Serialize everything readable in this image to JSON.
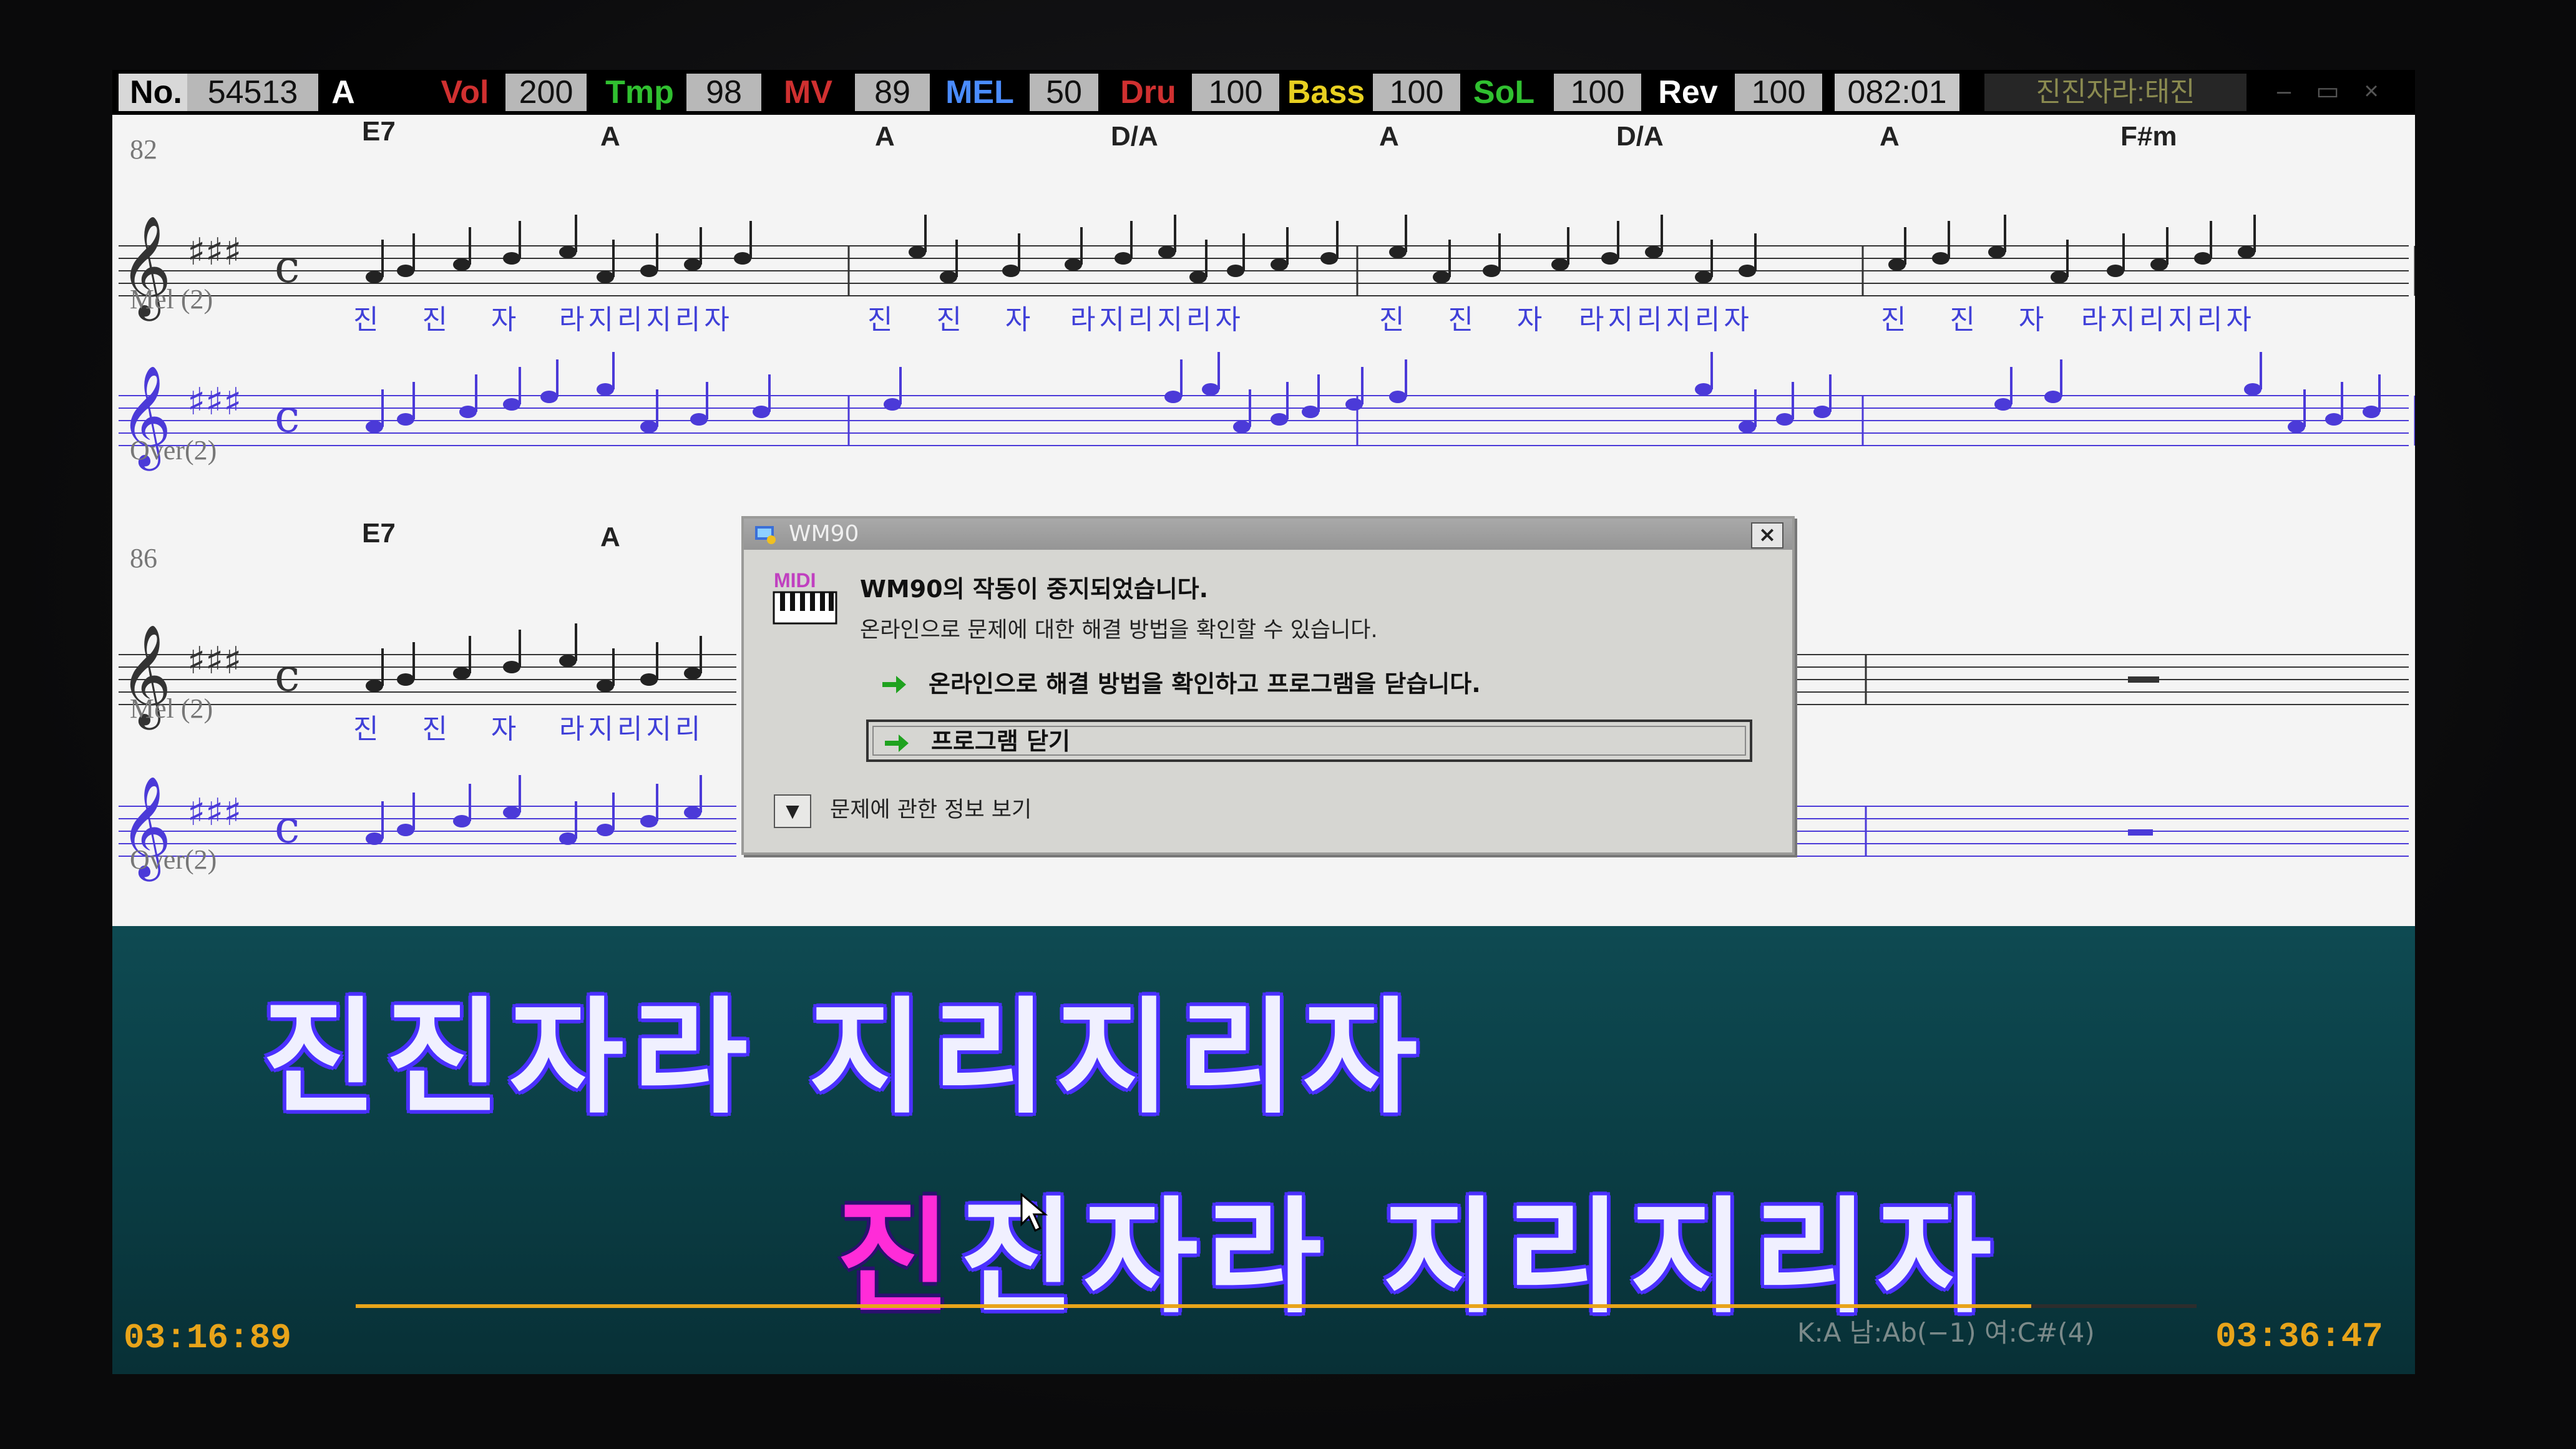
{
  "status_bar": {
    "items": [
      {
        "label": "No.",
        "value": "54513",
        "color": "#ffffff"
      },
      {
        "label": "A",
        "value": "",
        "color": "#ffffff"
      },
      {
        "label": "Vol",
        "value": "200",
        "color": "#d03030"
      },
      {
        "label": "Tmp",
        "value": "98",
        "color": "#30c030"
      },
      {
        "label": "MV",
        "value": "89",
        "color": "#d03030"
      },
      {
        "label": "MEL",
        "value": "50",
        "color": "#4a8cff"
      },
      {
        "label": "Dru",
        "value": "100",
        "color": "#d03030"
      },
      {
        "label": "Bass",
        "value": "100",
        "color": "#e8d020"
      },
      {
        "label": "SoL",
        "value": "100",
        "color": "#30c030"
      },
      {
        "label": "Rev",
        "value": "100",
        "color": "#ffffff"
      }
    ],
    "clock": "082:01",
    "song_title": "진진자라:태진"
  },
  "score": {
    "system1": {
      "measure": "82",
      "chords": [
        "E7",
        "A",
        "A",
        "D/A",
        "A",
        "D/A",
        "A",
        "F#m"
      ],
      "track1": "Mel (2)",
      "track2": "Over(2)",
      "lyrics": [
        "진 진 자",
        "라지리지리자",
        "진 진 자",
        "라지리지리자",
        "진 진 자",
        "라지리지리자",
        "진 진 자",
        "라지리지리자"
      ]
    },
    "system2": {
      "measure": "86",
      "chords": [
        "E7",
        "A"
      ],
      "track1": "Mel (2)",
      "track2": "Over(2)",
      "lyrics": [
        "진 진 자",
        "라지리지리"
      ]
    }
  },
  "dialog": {
    "title": "WM90",
    "close": "×",
    "icon_text": "MIDI",
    "heading": "WM90의 작동이 중지되었습니다.",
    "subtext": "온라인으로 문제에 대한 해결 방법을 확인할 수 있습니다.",
    "option_check_online": "온라인으로 해결 방법을 확인하고 프로그램을 닫습니다.",
    "option_close": "프로그램 닫기",
    "details": "문제에 관한 정보 보기",
    "arrow_color": "#1fa21f"
  },
  "lyrics_panel": {
    "line1": "진진자라 지리지리자",
    "line2_highlight": "진",
    "line2_rest": "진자라 지리지리자",
    "elapsed": "03:16:89",
    "total": "03:36:47",
    "key_info": "K:A 남:Ab(−1) 여:C#(4)",
    "progress": 0.91
  }
}
